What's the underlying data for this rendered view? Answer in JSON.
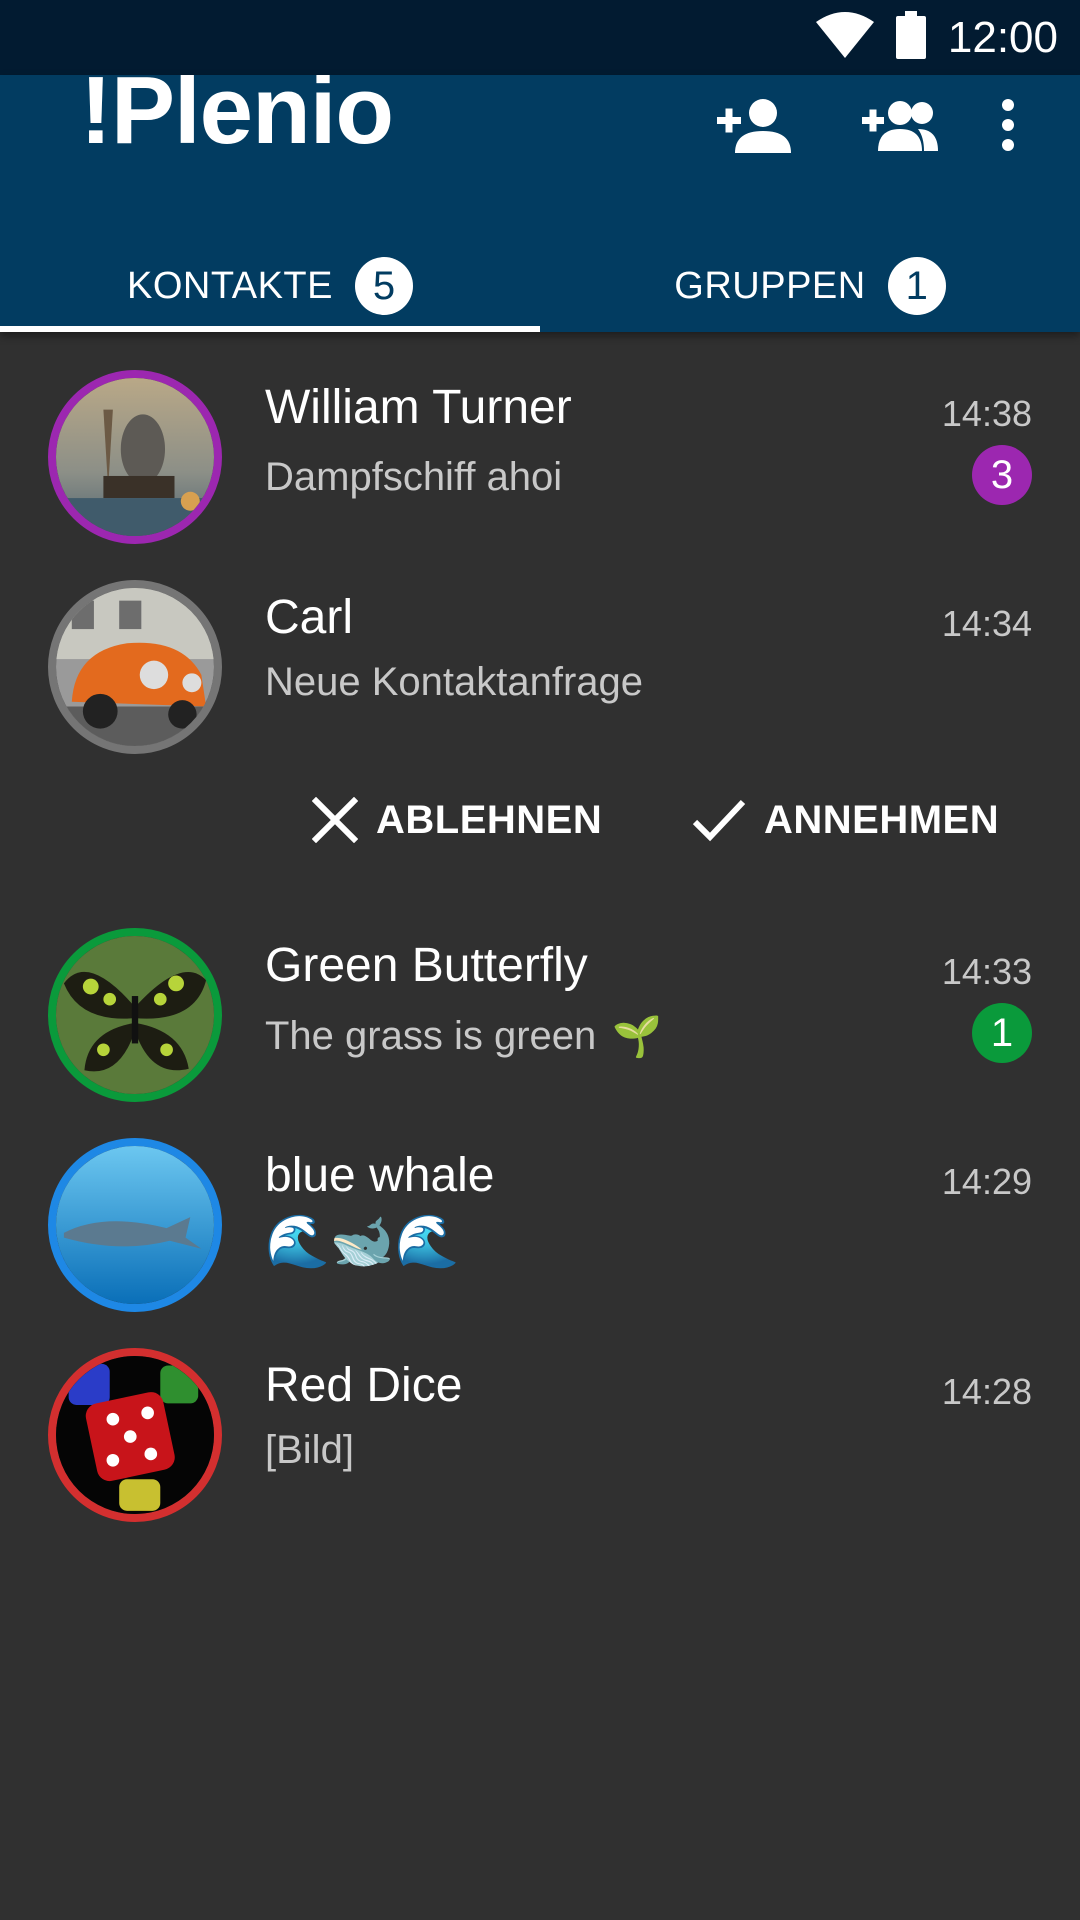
{
  "status_bar": {
    "time": "12:00",
    "icons": [
      "wifi-icon",
      "battery-icon"
    ]
  },
  "app_bar": {
    "title": "!Plenio",
    "actions": [
      "add-contact-icon",
      "add-group-icon",
      "more-vert-icon"
    ]
  },
  "tabs": [
    {
      "label": "KONTAKTE",
      "count": "5",
      "selected": true
    },
    {
      "label": "GRUPPEN",
      "count": "1",
      "selected": false
    }
  ],
  "colors": {
    "status_bar": "#021b31",
    "app_bar": "#023c61",
    "background": "#303030",
    "purple": "#9c27b0",
    "green": "#0a9a3b",
    "blue": "#1e88e5",
    "red": "#d32f2f",
    "grey": "#757575"
  },
  "contacts": [
    {
      "name": "William Turner",
      "time": "14:38",
      "preview": "Dampfschiff ahoi",
      "unread": "3",
      "ring_color": "#9c27b0",
      "avatar": "steamship-painting"
    },
    {
      "name": "Carl",
      "time": "14:34",
      "preview": "Neue Kontaktanfrage",
      "ring_color": "#757575",
      "avatar": "orange-beetle-car"
    },
    {
      "name": "Green Butterfly",
      "time": "14:33",
      "preview": "The grass is green",
      "preview_emoji": "🌱",
      "unread": "1",
      "ring_color": "#0a9a3b",
      "avatar": "butterfly"
    },
    {
      "name": "blue whale",
      "time": "14:29",
      "preview_emoji": "🌊🐋🌊",
      "ring_color": "#1e88e5",
      "avatar": "whale-underwater"
    },
    {
      "name": "Red Dice",
      "time": "14:28",
      "preview": "[Bild]",
      "ring_color": "#d32f2f",
      "avatar": "dice"
    }
  ],
  "contact_request": {
    "decline_label": "ABLEHNEN",
    "accept_label": "ANNEHMEN"
  }
}
